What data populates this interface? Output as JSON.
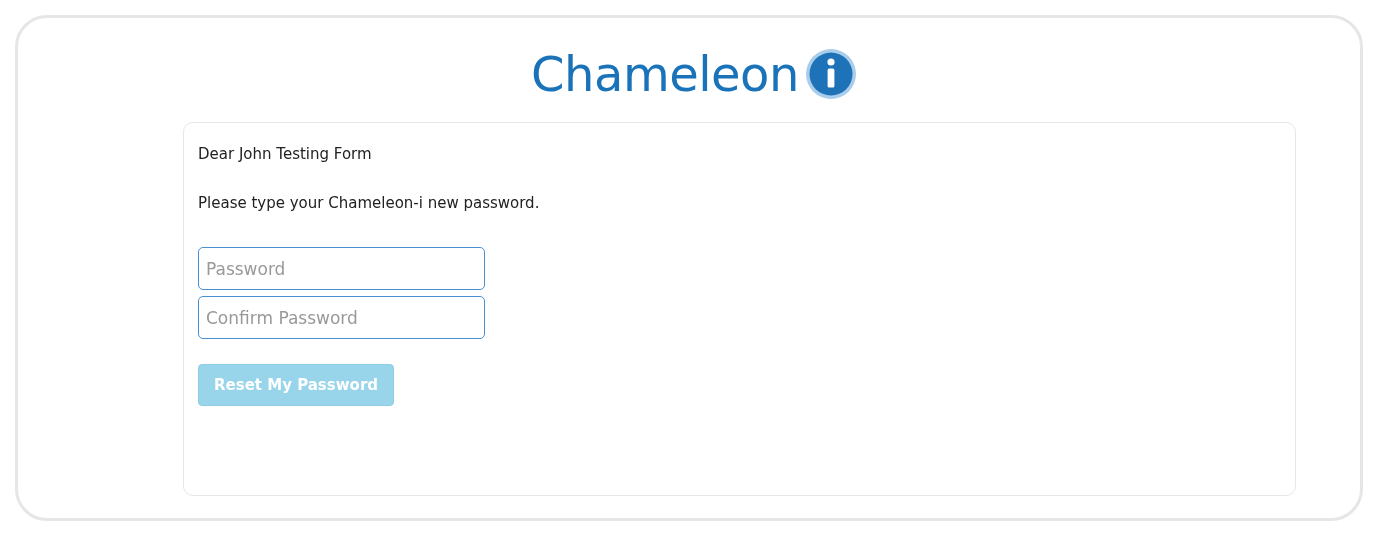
{
  "logo": {
    "text": "Chameleon"
  },
  "greeting": "Dear John Testing Form",
  "instruction": "Please type your Chameleon-i new password.",
  "fields": [
    {
      "placeholder": "Password"
    },
    {
      "placeholder": "Confirm Password"
    }
  ],
  "button": {
    "label": "Reset My Password",
    "disabled": true
  }
}
